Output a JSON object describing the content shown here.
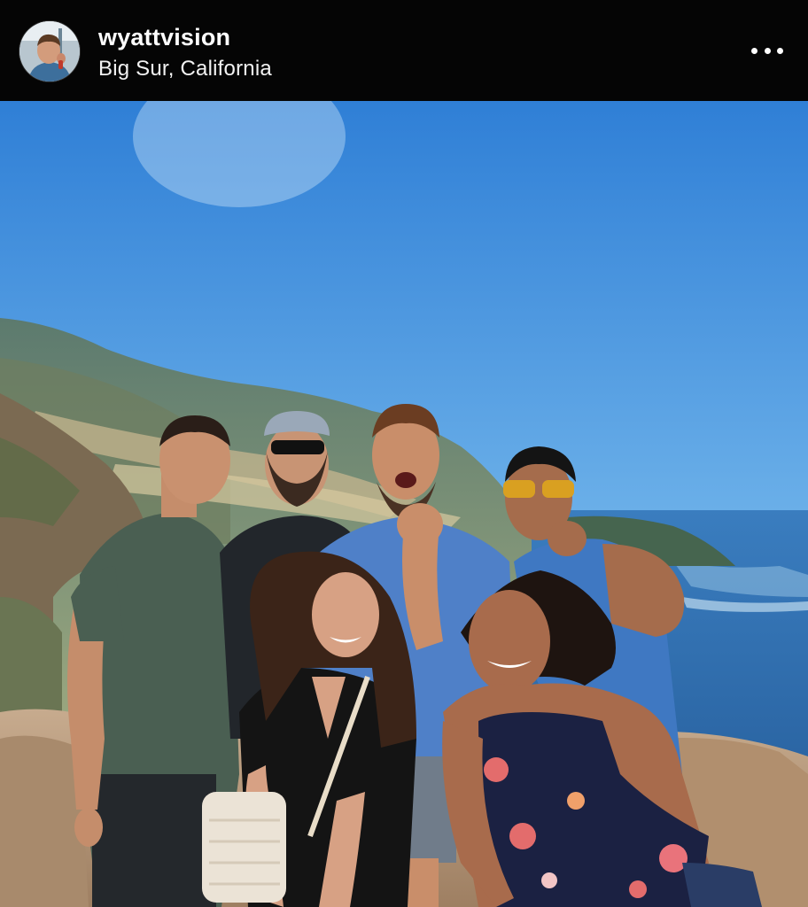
{
  "post": {
    "username": "wyattvision",
    "location": "Big Sur, California",
    "avatar_icon": "profile-avatar",
    "more_icon": "more-horizontal-icon"
  },
  "photo": {
    "subject": "group-photo",
    "colors": {
      "sky_top": "#2f7fd6",
      "sky_bottom": "#b6d9f2",
      "ocean": "#2f6fb0",
      "rock": "#b99c80",
      "header_bg": "#050505"
    }
  }
}
